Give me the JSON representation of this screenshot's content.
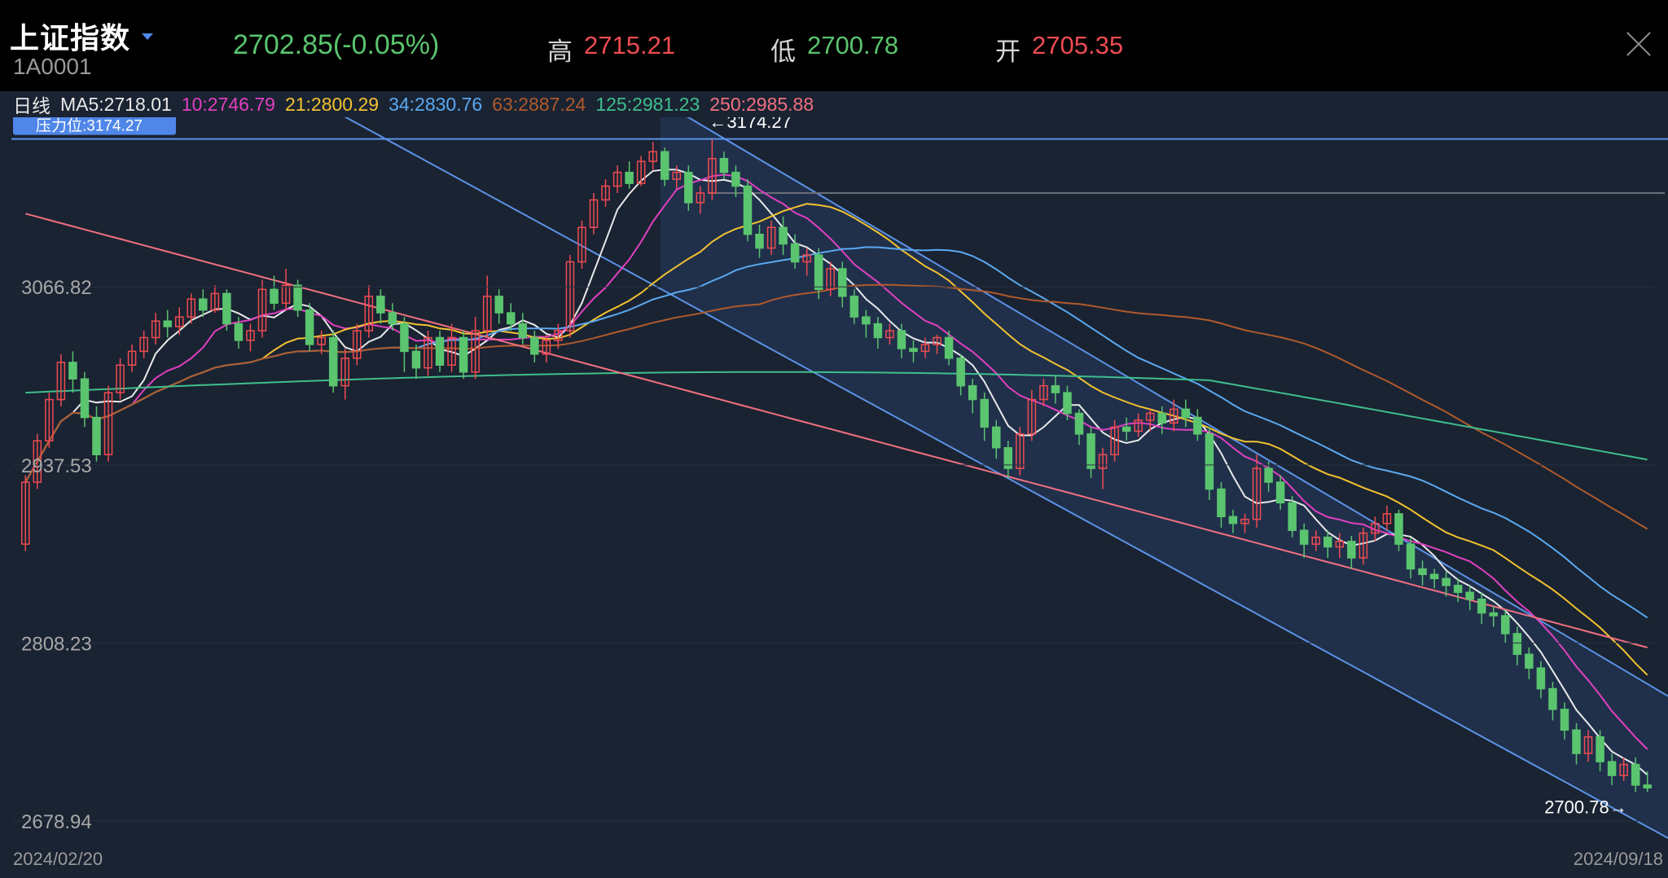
{
  "header": {
    "title": "上证指数",
    "code": "1A0001",
    "price": "2702.85(-0.05%)",
    "high_label": "高",
    "high_value": "2715.21",
    "low_label": "低",
    "low_value": "2700.78",
    "open_label": "开",
    "open_value": "2705.35"
  },
  "ma_row": {
    "period": "日线",
    "items": [
      {
        "label": "MA5:2718.01",
        "color": "#e8e8e8"
      },
      {
        "label": "10:2746.79",
        "color": "#e040c0"
      },
      {
        "label": "21:2800.29",
        "color": "#f2c230"
      },
      {
        "label": "34:2830.76",
        "color": "#5aa9f0"
      },
      {
        "label": "63:2887.24",
        "color": "#b05a2c"
      },
      {
        "label": "125:2981.23",
        "color": "#3fbf8c"
      },
      {
        "label": "250:2985.88",
        "color": "#f07080"
      }
    ]
  },
  "chart_data": {
    "type": "candlestick",
    "ylim": [
      2660,
      3190
    ],
    "y_ticks": [
      "3066.82",
      "2937.53",
      "2808.23",
      "2678.94"
    ],
    "x_labels": [
      "2024/02/20",
      "2024/09/18"
    ],
    "resistance_label": "压力位:3174.27",
    "resistance_value": 3174.27,
    "high_marker": "←3174.27",
    "low_marker": "2700.78→",
    "colors": {
      "up": "#ef4b52",
      "down": "#5ac46e",
      "channel": "#5b93e6"
    },
    "candles": [
      [
        2880,
        2925,
        2875,
        2930
      ],
      [
        2925,
        2955,
        2920,
        2960
      ],
      [
        2955,
        2985,
        2950,
        2990
      ],
      [
        2985,
        3012,
        2980,
        3018
      ],
      [
        3012,
        3000,
        2990,
        3020
      ],
      [
        3000,
        2972,
        2965,
        3005
      ],
      [
        2972,
        2945,
        2940,
        2980
      ],
      [
        2945,
        2990,
        2940,
        2995
      ],
      [
        2990,
        3010,
        2985,
        3015
      ],
      [
        3010,
        3020,
        3005,
        3025
      ],
      [
        3020,
        3030,
        3015,
        3035
      ],
      [
        3030,
        3042,
        3025,
        3048
      ],
      [
        3042,
        3038,
        3030,
        3050
      ],
      [
        3038,
        3045,
        3032,
        3052
      ],
      [
        3045,
        3058,
        3040,
        3062
      ],
      [
        3058,
        3050,
        3045,
        3065
      ],
      [
        3050,
        3062,
        3048,
        3068
      ],
      [
        3062,
        3040,
        3035,
        3065
      ],
      [
        3040,
        3028,
        3022,
        3045
      ],
      [
        3028,
        3035,
        3020,
        3040
      ],
      [
        3035,
        3065,
        3030,
        3072
      ],
      [
        3065,
        3055,
        3050,
        3075
      ],
      [
        3055,
        3068,
        3050,
        3080
      ],
      [
        3068,
        3050,
        3045,
        3072
      ],
      [
        3050,
        3025,
        3020,
        3055
      ],
      [
        3025,
        3030,
        3018,
        3035
      ],
      [
        3030,
        2995,
        2990,
        3035
      ],
      [
        2995,
        3015,
        2985,
        3022
      ],
      [
        3015,
        3035,
        3010,
        3040
      ],
      [
        3035,
        3060,
        3030,
        3068
      ],
      [
        3060,
        3048,
        3040,
        3065
      ],
      [
        3048,
        3040,
        3035,
        3055
      ],
      [
        3040,
        3020,
        3005,
        3045
      ],
      [
        3020,
        3008,
        3000,
        3025
      ],
      [
        3008,
        3030,
        3002,
        3035
      ],
      [
        3030,
        3010,
        3005,
        3035
      ],
      [
        3010,
        3030,
        3005,
        3040
      ],
      [
        3030,
        3005,
        3000,
        3035
      ],
      [
        3005,
        3035,
        3000,
        3045
      ],
      [
        3035,
        3060,
        3030,
        3075
      ],
      [
        3060,
        3048,
        3040,
        3065
      ],
      [
        3048,
        3040,
        3035,
        3055
      ],
      [
        3040,
        3030,
        3025,
        3048
      ],
      [
        3030,
        3018,
        3012,
        3035
      ],
      [
        3018,
        3028,
        3012,
        3032
      ],
      [
        3028,
        3035,
        3022,
        3040
      ],
      [
        3035,
        3085,
        3030,
        3090
      ],
      [
        3085,
        3110,
        3080,
        3115
      ],
      [
        3110,
        3130,
        3105,
        3135
      ],
      [
        3130,
        3140,
        3125,
        3145
      ],
      [
        3140,
        3150,
        3135,
        3155
      ],
      [
        3150,
        3142,
        3138,
        3158
      ],
      [
        3142,
        3158,
        3140,
        3162
      ],
      [
        3158,
        3165,
        3152,
        3172
      ],
      [
        3165,
        3145,
        3140,
        3168
      ],
      [
        3145,
        3150,
        3138,
        3155
      ],
      [
        3150,
        3128,
        3122,
        3155
      ],
      [
        3128,
        3135,
        3120,
        3140
      ],
      [
        3135,
        3160,
        3130,
        3174
      ],
      [
        3160,
        3150,
        3145,
        3165
      ],
      [
        3150,
        3140,
        3132,
        3155
      ],
      [
        3140,
        3105,
        3100,
        3145
      ],
      [
        3105,
        3095,
        3088,
        3112
      ],
      [
        3095,
        3110,
        3090,
        3115
      ],
      [
        3110,
        3098,
        3090,
        3118
      ],
      [
        3098,
        3085,
        3080,
        3105
      ],
      [
        3085,
        3090,
        3075,
        3095
      ],
      [
        3090,
        3065,
        3058,
        3095
      ],
      [
        3065,
        3080,
        3060,
        3085
      ],
      [
        3080,
        3060,
        3052,
        3085
      ],
      [
        3060,
        3045,
        3040,
        3065
      ],
      [
        3045,
        3040,
        3030,
        3050
      ],
      [
        3040,
        3030,
        3022,
        3045
      ],
      [
        3030,
        3035,
        3025,
        3040
      ],
      [
        3035,
        3022,
        3015,
        3040
      ],
      [
        3022,
        3020,
        3012,
        3028
      ],
      [
        3020,
        3025,
        3015,
        3030
      ],
      [
        3025,
        3030,
        3018,
        3032
      ],
      [
        3030,
        3015,
        3010,
        3035
      ],
      [
        3015,
        2995,
        2988,
        3018
      ],
      [
        2995,
        2985,
        2975,
        3000
      ],
      [
        2985,
        2965,
        2955,
        2990
      ],
      [
        2965,
        2950,
        2942,
        2970
      ],
      [
        2950,
        2935,
        2928,
        2955
      ],
      [
        2935,
        2960,
        2930,
        2965
      ],
      [
        2960,
        2985,
        2955,
        2992
      ],
      [
        2985,
        2995,
        2980,
        3000
      ],
      [
        2995,
        2990,
        2982,
        3002
      ],
      [
        2990,
        2975,
        2970,
        2995
      ],
      [
        2975,
        2960,
        2952,
        2978
      ],
      [
        2960,
        2935,
        2928,
        2965
      ],
      [
        2935,
        2945,
        2920,
        2950
      ],
      [
        2945,
        2965,
        2940,
        2970
      ],
      [
        2965,
        2962,
        2955,
        2972
      ],
      [
        2962,
        2970,
        2958,
        2975
      ],
      [
        2970,
        2975,
        2962,
        2978
      ],
      [
        2975,
        2968,
        2960,
        2980
      ],
      [
        2968,
        2978,
        2962,
        2985
      ],
      [
        2978,
        2972,
        2965,
        2985
      ],
      [
        2972,
        2960,
        2955,
        2978
      ],
      [
        2960,
        2920,
        2912,
        2965
      ],
      [
        2920,
        2900,
        2892,
        2925
      ],
      [
        2900,
        2895,
        2888,
        2905
      ],
      [
        2895,
        2898,
        2888,
        2902
      ],
      [
        2898,
        2935,
        2892,
        2945
      ],
      [
        2935,
        2925,
        2918,
        2940
      ],
      [
        2925,
        2910,
        2905,
        2930
      ],
      [
        2910,
        2890,
        2885,
        2915
      ],
      [
        2890,
        2880,
        2870,
        2895
      ],
      [
        2880,
        2885,
        2875,
        2890
      ],
      [
        2885,
        2878,
        2870,
        2890
      ],
      [
        2878,
        2882,
        2870,
        2888
      ],
      [
        2882,
        2870,
        2862,
        2886
      ],
      [
        2870,
        2888,
        2865,
        2892
      ],
      [
        2888,
        2895,
        2882,
        2900
      ],
      [
        2895,
        2902,
        2890,
        2908
      ],
      [
        2902,
        2880,
        2875,
        2905
      ],
      [
        2880,
        2862,
        2855,
        2885
      ],
      [
        2862,
        2858,
        2850,
        2868
      ],
      [
        2858,
        2855,
        2848,
        2862
      ],
      [
        2855,
        2850,
        2842,
        2860
      ],
      [
        2850,
        2845,
        2838,
        2855
      ],
      [
        2845,
        2840,
        2832,
        2850
      ],
      [
        2840,
        2830,
        2822,
        2845
      ],
      [
        2830,
        2828,
        2820,
        2835
      ],
      [
        2828,
        2815,
        2808,
        2832
      ],
      [
        2815,
        2800,
        2792,
        2820
      ],
      [
        2800,
        2790,
        2782,
        2805
      ],
      [
        2790,
        2775,
        2768,
        2795
      ],
      [
        2775,
        2760,
        2752,
        2780
      ],
      [
        2760,
        2745,
        2738,
        2765
      ],
      [
        2745,
        2728,
        2720,
        2750
      ],
      [
        2728,
        2740,
        2722,
        2745
      ],
      [
        2740,
        2722,
        2715,
        2745
      ],
      [
        2722,
        2712,
        2705,
        2728
      ],
      [
        2712,
        2720,
        2708,
        2725
      ],
      [
        2720,
        2705,
        2700,
        2725
      ],
      [
        2705,
        2703,
        2700,
        2715
      ]
    ]
  }
}
